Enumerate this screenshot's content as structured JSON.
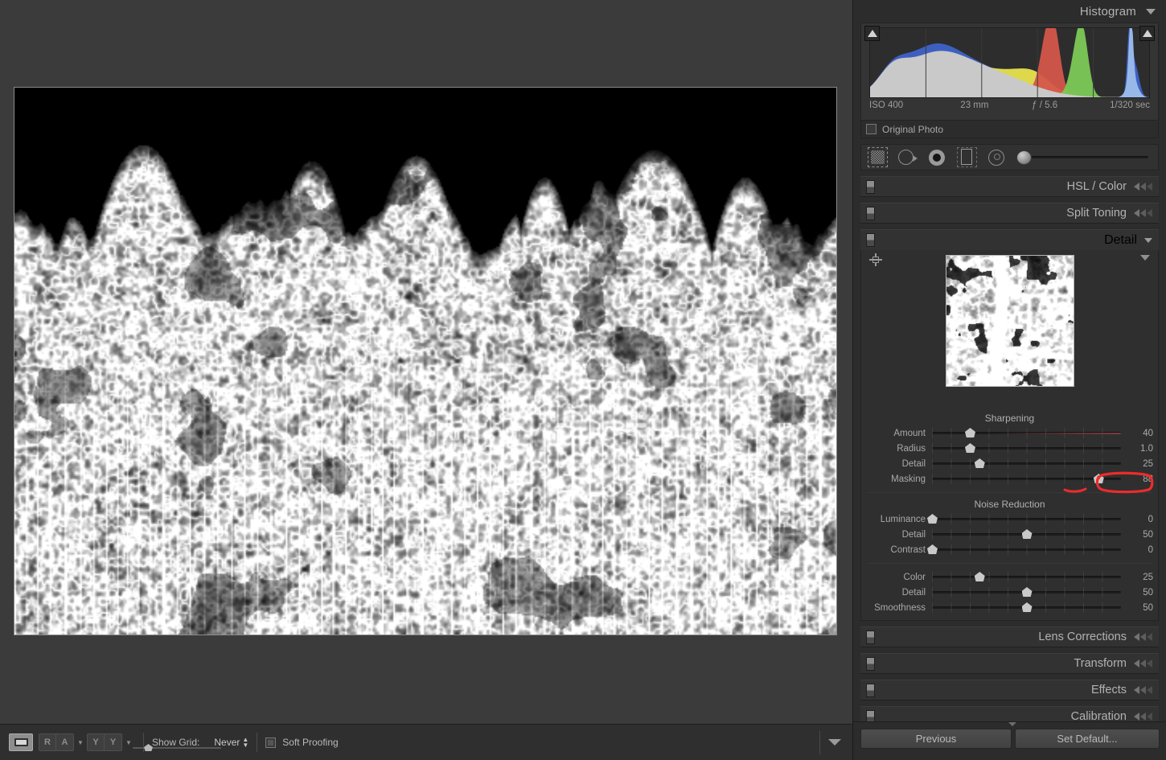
{
  "histogram": {
    "title": "Histogram",
    "collapse_icon": "chevron-down-icon",
    "meta": {
      "iso": "ISO 400",
      "focal": "23 mm",
      "aperture": "ƒ / 5.6",
      "shutter": "1/320 sec"
    },
    "original_photo_label": "Original Photo",
    "clip_left_icon": "shadow-clipping-triangle",
    "clip_right_icon": "highlight-clipping-triangle",
    "colors": {
      "red": "#d4564a",
      "green": "#7cc956",
      "blue": "#3e63c8",
      "yellow": "#e8e14e",
      "magenta": "#d03ba8",
      "gray": "#c9c9c9",
      "blue_spike": "#9fc0ee"
    }
  },
  "tool_strip": {
    "tools": [
      {
        "name": "crop-overlay-tool",
        "icon": "crop-icon"
      },
      {
        "name": "spot-removal-tool",
        "icon": "spot-removal-icon"
      },
      {
        "name": "red-eye-tool",
        "icon": "red-eye-icon"
      },
      {
        "name": "graduated-filter-tool",
        "icon": "graduated-filter-icon"
      },
      {
        "name": "radial-filter-tool",
        "icon": "radial-filter-icon"
      }
    ],
    "brush_slider_value": 0
  },
  "panels": [
    {
      "title": "HSL / Color",
      "expanded": false
    },
    {
      "title": "Split Toning",
      "expanded": false
    }
  ],
  "detail": {
    "title": "Detail",
    "target_icon": "loupe-target-icon",
    "preview_caret_icon": "chevron-down-icon",
    "sharpening": {
      "title": "Sharpening",
      "sliders": [
        {
          "label": "Amount",
          "value": "40",
          "pct": 20,
          "warm": true
        },
        {
          "label": "Radius",
          "value": "1.0",
          "pct": 20,
          "warm": false
        },
        {
          "label": "Detail",
          "value": "25",
          "pct": 25,
          "warm": false
        },
        {
          "label": "Masking",
          "value": "88",
          "pct": 88,
          "warm": false,
          "annotated": true
        }
      ]
    },
    "noise_reduction": {
      "title": "Noise Reduction",
      "sliders": [
        {
          "label": "Luminance",
          "value": "0",
          "pct": 0,
          "warm": false
        },
        {
          "label": "Detail",
          "value": "50",
          "pct": 50,
          "warm": false
        },
        {
          "label": "Contrast",
          "value": "0",
          "pct": 0,
          "warm": false
        }
      ],
      "color_sliders": [
        {
          "label": "Color",
          "value": "25",
          "pct": 25,
          "warm": false
        },
        {
          "label": "Detail",
          "value": "50",
          "pct": 50,
          "warm": false
        },
        {
          "label": "Smoothness",
          "value": "50",
          "pct": 50,
          "warm": false
        }
      ]
    }
  },
  "panels_bottom": [
    {
      "title": "Lens Corrections",
      "expanded": false
    },
    {
      "title": "Transform",
      "expanded": false
    },
    {
      "title": "Effects",
      "expanded": false
    },
    {
      "title": "Calibration",
      "expanded": false
    }
  ],
  "panel_buttons": {
    "previous": "Previous",
    "set_default": "Set Default..."
  },
  "viewer_toolbar": {
    "loupe_view_icon": "loupe-view-icon",
    "before_after_label_left": "R",
    "before_after_label_right": "A",
    "before_after_caret": "chevron-down-icon",
    "ya_label_left": "Y",
    "ya_label_right": "Y",
    "ya_caret": "chevron-down-icon",
    "show_grid_label": "Show Grid:",
    "show_grid_value": "Never",
    "grid_slider_value": 14,
    "soft_proofing_label": "Soft Proofing",
    "soft_proofing_checked": false,
    "panel_caret_icon": "chevron-down-icon"
  },
  "annotation": {
    "color": "#ee2b2b",
    "shape": "rounded-rectangle-highlight",
    "target": "masking-value"
  }
}
